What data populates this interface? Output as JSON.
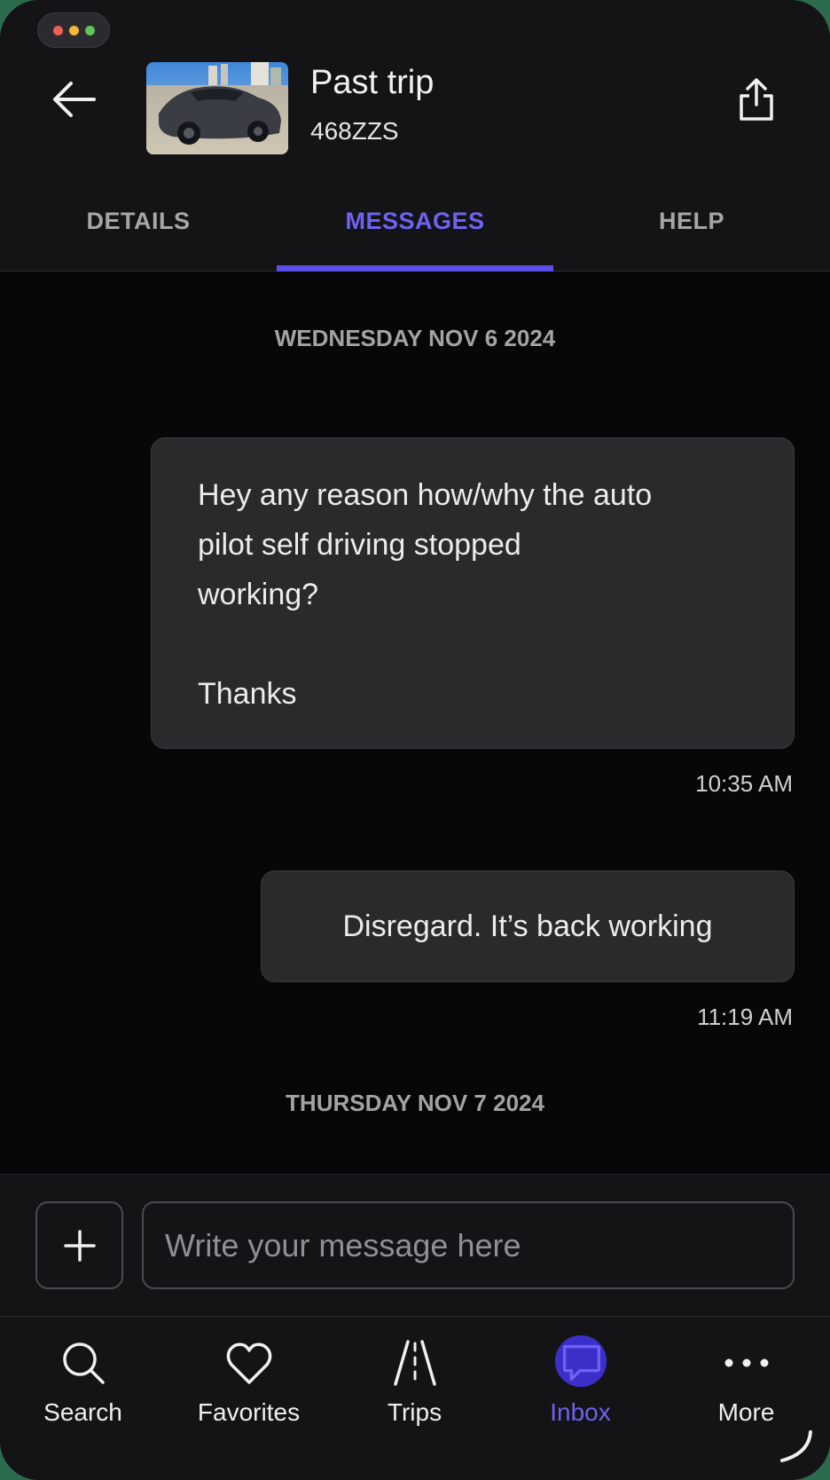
{
  "header": {
    "title": "Past trip",
    "plate": "468ZZS"
  },
  "tabs": [
    {
      "label": "DETAILS",
      "active": false
    },
    {
      "label": "MESSAGES",
      "active": true
    },
    {
      "label": "HELP",
      "active": false
    }
  ],
  "messages": {
    "day1": "WEDNESDAY NOV 6 2024",
    "msg1_text": "Hey any reason how/why the auto\npilot self driving stopped\nworking?\n\nThanks",
    "msg1_time": "10:35 AM",
    "msg2_text": "Disregard. It’s back working",
    "msg2_time": "11:19 AM",
    "day2": "THURSDAY NOV 7 2024"
  },
  "composer": {
    "placeholder": "Write your message here"
  },
  "nav": [
    {
      "label": "Search",
      "icon": "search-icon"
    },
    {
      "label": "Favorites",
      "icon": "heart-icon"
    },
    {
      "label": "Trips",
      "icon": "road-icon"
    },
    {
      "label": "Inbox",
      "icon": "chat-bubble-icon",
      "active": true
    },
    {
      "label": "More",
      "icon": "more-dots-icon"
    }
  ],
  "colors": {
    "accent": "#5a4fe8",
    "background": "#07070a",
    "bubble": "#2a2a2d"
  }
}
